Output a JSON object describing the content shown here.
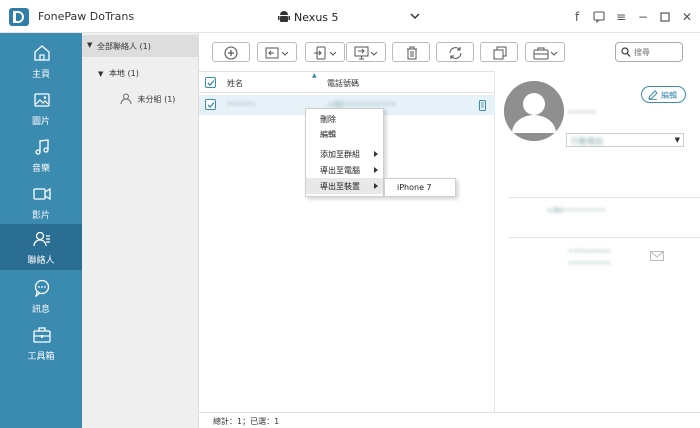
{
  "app": {
    "title": "FonePaw DoTrans",
    "device": "Nexus 5"
  },
  "sidebar": {
    "items": [
      {
        "label": "主頁",
        "icon": "home-icon"
      },
      {
        "label": "圖片",
        "icon": "photo-icon"
      },
      {
        "label": "音樂",
        "icon": "music-icon"
      },
      {
        "label": "影片",
        "icon": "video-icon"
      },
      {
        "label": "聯絡人",
        "icon": "contacts-icon",
        "active": true
      },
      {
        "label": "訊息",
        "icon": "message-icon"
      },
      {
        "label": "工具箱",
        "icon": "toolbox-icon"
      }
    ]
  },
  "groups": {
    "all": "全部聯絡人 (1)",
    "local": "本地 (1)",
    "ungrouped": "未分組 (1)"
  },
  "toolbar": {
    "search_placeholder": "搜尋"
  },
  "list": {
    "col_name": "姓名",
    "col_phone": "電話號碼",
    "rows": [
      {
        "name": "••••••",
        "phone": "+86•••••••••••"
      }
    ]
  },
  "context_menu": {
    "items": [
      "刪除",
      "編輯",
      "添加至群組",
      "導出至電腦",
      "導出至裝置"
    ],
    "submenu_item": "iPhone 7"
  },
  "status": {
    "text": "總計：1；已選：1"
  },
  "detail": {
    "edit_label": "編輯",
    "field_select": "行動電話",
    "blur_lines": [
      "••••••",
      "+86•••••••••",
      "•••••••••",
      "•••••••••"
    ]
  },
  "colors": {
    "accent": "#3b8ab0",
    "sidebar": "#3b8ab0",
    "sidebar_active": "#2a6f93"
  }
}
